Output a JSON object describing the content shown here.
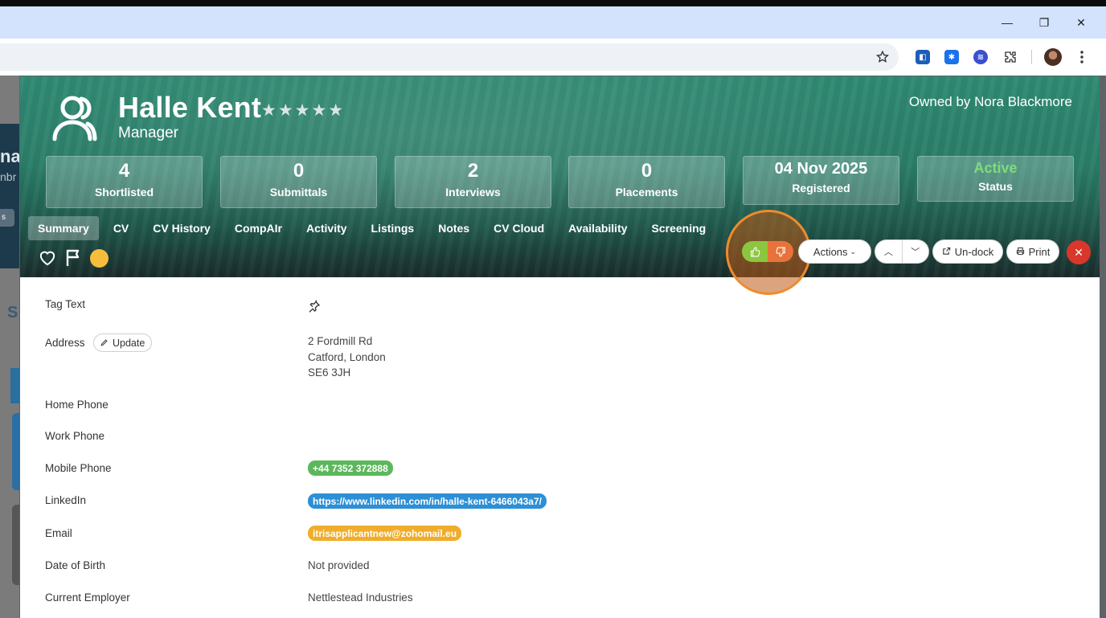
{
  "browser": {
    "window_controls": {
      "minimize": "—",
      "restore": "❐",
      "close": "✕"
    }
  },
  "background_page": {
    "text1": "na",
    "text2": "nbr",
    "pill": "s",
    "section_letter": "S"
  },
  "candidate": {
    "name": "Halle Kent",
    "title": "Manager",
    "stars": "★★★★★",
    "owner": "Owned by Nora Blackmore"
  },
  "stats": [
    {
      "value": "4",
      "label": "Shortlisted"
    },
    {
      "value": "0",
      "label": "Submittals"
    },
    {
      "value": "2",
      "label": "Interviews"
    },
    {
      "value": "0",
      "label": "Placements"
    },
    {
      "value": "04 Nov 2025",
      "label": "Registered"
    },
    {
      "value": "Active",
      "label": "Status"
    }
  ],
  "tabs": [
    "Summary",
    "CV",
    "CV History",
    "CompAIr",
    "Activity",
    "Listings",
    "Notes",
    "CV Cloud",
    "Availability",
    "Screening"
  ],
  "buttons": {
    "actions": "Actions",
    "undock": "Un-dock",
    "print": "Print",
    "close": "✕",
    "update": "Update"
  },
  "details": {
    "tag_text_label": "Tag Text",
    "address_label": "Address",
    "address_line1": "2 Fordmill Rd",
    "address_line2": "Catford, London",
    "address_line3": "SE6 3JH",
    "home_phone_label": "Home Phone",
    "work_phone_label": "Work Phone",
    "mobile_phone_label": "Mobile Phone",
    "mobile_phone": "+44 7352 372888",
    "linkedin_label": "LinkedIn",
    "linkedin": "https://www.linkedin.com/in/halle-kent-6466043a7/",
    "email_label": "Email",
    "email": "itrisapplicantnew@zohomail.eu",
    "dob_label": "Date of Birth",
    "dob": "Not provided",
    "employer_label": "Current Employer",
    "employer": "Nettlestead Industries"
  },
  "colors": {
    "hero_top": "#2f8a73",
    "thumb_up": "#8cc63f",
    "thumb_down": "#e8733a",
    "status_active": "#7ddc7a",
    "close_button": "#d9372b",
    "highlight_ring": "#f08b2c"
  }
}
